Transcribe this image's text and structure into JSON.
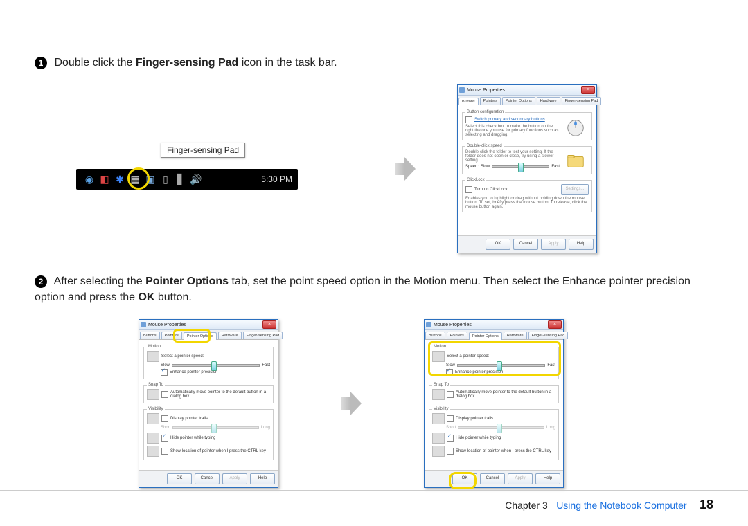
{
  "steps": {
    "one_a": "Double click the ",
    "one_b": "Finger-sensing Pad",
    "one_c": " icon in the task bar.",
    "two_a": "After selecting the ",
    "two_b": "Pointer Options",
    "two_c": " tab, set the point speed option in the Motion menu. Then select the Enhance pointer precision option and press the ",
    "two_d": "OK",
    "two_e": " button."
  },
  "taskbar": {
    "tooltip": "Finger-sensing Pad",
    "time": "5:30 PM"
  },
  "dialog": {
    "title": "Mouse Properties",
    "close": "×",
    "tabs": {
      "buttons": "Buttons",
      "pointers": "Pointers",
      "pointer_options": "Pointer Options",
      "hardware": "Hardware",
      "fsp": "Finger-sensing Pad"
    },
    "buttons_tab": {
      "group1": "Button configuration",
      "switch": "Switch primary and secondary buttons",
      "desc1": "Select this check box to make the button on the right the one you use for primary functions such as selecting and dragging.",
      "group2": "Double-click speed",
      "desc2": "Double-click the folder to test your setting. If the folder does not open or close, try using a slower setting.",
      "speed": "Speed:",
      "slow": "Slow",
      "fast": "Fast",
      "group3": "ClickLock",
      "clicklock": "Turn on ClickLock",
      "settings": "Settings...",
      "desc3": "Enables you to highlight or drag without holding down the mouse button. To set, briefly press the mouse button. To release, click the mouse button again."
    },
    "po_tab": {
      "group_motion": "Motion",
      "select_speed": "Select a pointer speed:",
      "slow": "Slow",
      "fast": "Fast",
      "enhance": "Enhance pointer precision",
      "group_snap": "Snap To",
      "snap": "Automatically move pointer to the default button in a dialog box",
      "group_vis": "Visibility",
      "trails": "Display pointer trails",
      "short": "Short",
      "long": "Long",
      "hide": "Hide pointer while typing",
      "ctrl": "Show location of pointer when I press the CTRL key"
    },
    "buttons": {
      "ok": "OK",
      "cancel": "Cancel",
      "apply": "Apply",
      "help": "Help"
    }
  },
  "footer": {
    "chapter": "Chapter 3",
    "title": "Using the Notebook Computer",
    "page": "18"
  }
}
